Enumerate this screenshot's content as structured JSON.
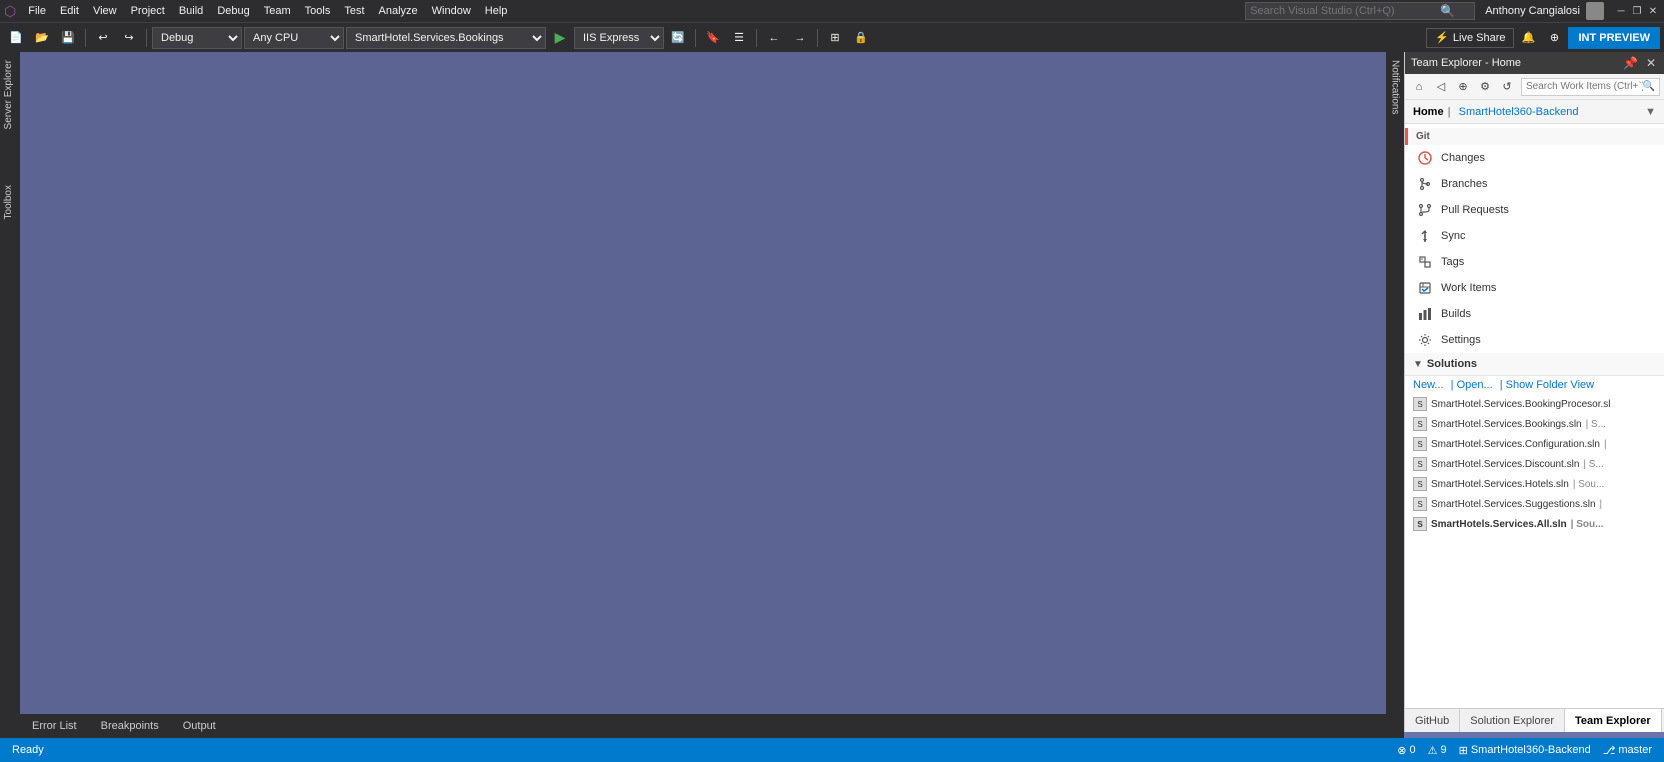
{
  "app": {
    "title": "Visual Studio",
    "vs_icon": "◈"
  },
  "menu": {
    "items": [
      "File",
      "Edit",
      "View",
      "Project",
      "Build",
      "Debug",
      "Team",
      "Tools",
      "Test",
      "Analyze",
      "Window",
      "Help"
    ]
  },
  "search": {
    "placeholder": "Search Visual Studio (Ctrl+Q)"
  },
  "window_controls": {
    "minimize": "─",
    "restore": "❐",
    "close": "✕"
  },
  "toolbar": {
    "debug_config": "Debug",
    "platform": "Any CPU",
    "project": "SmartHotel.Services.Bookings",
    "iis_express": "IIS Express"
  },
  "user": {
    "name": "Anthony Cangialosi"
  },
  "live_share": {
    "label": "Live Share"
  },
  "int_preview": {
    "label": "INT PREVIEW"
  },
  "left_panels": {
    "server_explorer": "Server Explorer",
    "toolbox": "Toolbox"
  },
  "team_explorer": {
    "title": "Team Explorer - Home",
    "home_label": "Home",
    "repo_name": "SmartHotel360-Backend",
    "search_placeholder": "Search Work Items (Ctrl+`)",
    "nav_items": [
      {
        "label": "Changes",
        "icon": "clock"
      },
      {
        "label": "Branches",
        "icon": "branches"
      },
      {
        "label": "Pull Requests",
        "icon": "pull-request"
      },
      {
        "label": "Sync",
        "icon": "sync"
      },
      {
        "label": "Tags",
        "icon": "tags"
      },
      {
        "label": "Work Items",
        "icon": "work-items"
      },
      {
        "label": "Builds",
        "icon": "builds"
      },
      {
        "label": "Settings",
        "icon": "settings"
      }
    ],
    "solutions_section": "Solutions",
    "solutions_links": [
      "New...",
      "Open...",
      "Show Folder View"
    ],
    "solution_files": [
      {
        "name": "SmartHotel.Services.BookingProcesor.sl",
        "suffix": "",
        "bold": false
      },
      {
        "name": "SmartHotel.Services.Bookings.sln",
        "suffix": "| S...",
        "bold": false
      },
      {
        "name": "SmartHotel.Services.Configuration.sln",
        "suffix": "|",
        "bold": false
      },
      {
        "name": "SmartHotel.Services.Discount.sln",
        "suffix": "| S...",
        "bold": false
      },
      {
        "name": "SmartHotel.Services.Hotels.sln",
        "suffix": "| Sou...",
        "bold": false
      },
      {
        "name": "SmartHotel.Services.Suggestions.sln",
        "suffix": "|",
        "bold": false
      },
      {
        "name": "SmartHotels.Services.All.sln",
        "suffix": "| Sou...",
        "bold": true
      }
    ],
    "bottom_tabs": [
      "GitHub",
      "Solution Explorer",
      "Team Explorer"
    ],
    "active_bottom_tab": "Team Explorer"
  },
  "notif_sidebar": {
    "label": "Notifications"
  },
  "bottom_tabs": {
    "items": [
      "Error List",
      "Breakpoints",
      "Output"
    ],
    "active": ""
  },
  "status_bar": {
    "ready": "Ready",
    "errors": "0",
    "warnings": "9",
    "repo": "SmartHotel360-Backend",
    "branch": "master"
  }
}
